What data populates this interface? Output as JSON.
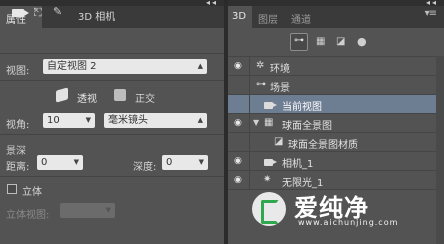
{
  "properties_panel": {
    "tab_title": "属性",
    "tab_close": "✕",
    "panel_menu": "▾≡",
    "top_controls": "◂◂",
    "section_label": "3D 相机",
    "view": {
      "label": "视图:",
      "value": "自定视图 2"
    },
    "projection": {
      "perspective": "透视",
      "orthographic": "正交"
    },
    "angle": {
      "label": "视角:",
      "value": "10",
      "lens_value": "毫米镜头"
    },
    "depth_of_field": {
      "title": "景深",
      "distance_label": "距离:",
      "distance_value": "0",
      "depth_label": "深度:",
      "depth_value": "0"
    },
    "stereo": {
      "label": "立体",
      "checked": false,
      "view_label": "立体视图:",
      "view_value": ""
    }
  },
  "scene_panel": {
    "tabs": [
      "3D",
      "图层",
      "通道"
    ],
    "active_tab": "3D",
    "panel_menu": "▾≡",
    "top_controls": "◂◂",
    "tree": [
      {
        "label": "环境",
        "icon": "environment-icon",
        "visible": true,
        "indent": 0
      },
      {
        "label": "场景",
        "icon": "scene-icon",
        "visible": false,
        "indent": 0
      },
      {
        "label": "当前视图",
        "icon": "camera-icon",
        "visible": false,
        "indent": 1,
        "selected": true
      },
      {
        "label": "球面全景图",
        "icon": "mesh-icon",
        "visible": true,
        "indent": 1,
        "expanded": true
      },
      {
        "label": "球面全景图材质",
        "icon": "material-icon",
        "visible": false,
        "indent": 2
      },
      {
        "label": "相机_1",
        "icon": "camera-icon",
        "visible": true,
        "indent": 1
      },
      {
        "label": "无限光_1",
        "icon": "light-icon",
        "visible": true,
        "indent": 1
      }
    ]
  },
  "watermark": {
    "text": "爱纯净",
    "url": "www.aichunjing.com"
  },
  "colors": {
    "panel_bg": "#535353",
    "selection": "#6d7d92",
    "tab_bar": "#3a3a3a"
  }
}
